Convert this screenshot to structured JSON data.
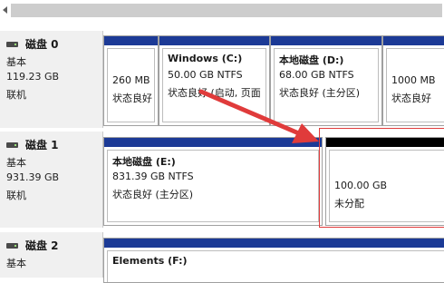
{
  "disks": [
    {
      "name": "磁盘 0",
      "type": "基本",
      "size": "119.23 GB",
      "status": "联机",
      "partitions": [
        {
          "title": "",
          "size": "260 MB",
          "status": "状态良好"
        },
        {
          "title": "Windows  (C:)",
          "size": "50.00 GB NTFS",
          "status": "状态良好 (启动, 页面"
        },
        {
          "title": "本地磁盘  (D:)",
          "size": "68.00 GB NTFS",
          "status": "状态良好 (主分区)"
        },
        {
          "title": "",
          "size": "1000 MB",
          "status": "状态良好"
        }
      ]
    },
    {
      "name": "磁盘 1",
      "type": "基本",
      "size": "931.39 GB",
      "status": "联机",
      "partitions": [
        {
          "title": "本地磁盘  (E:)",
          "size": "831.39 GB NTFS",
          "status": "状态良好 (主分区)"
        },
        {
          "title": "",
          "size": "100.00 GB",
          "status": "未分配"
        }
      ]
    },
    {
      "name": "磁盘 2",
      "type": "基本",
      "size": "",
      "status": "",
      "partitions": [
        {
          "title": "Elements  (F:)",
          "size": "",
          "status": ""
        }
      ]
    }
  ],
  "colors": {
    "primary_bar": "#1c3a96",
    "unallocated_bar": "#000000",
    "annotation": "#e03b3b"
  }
}
